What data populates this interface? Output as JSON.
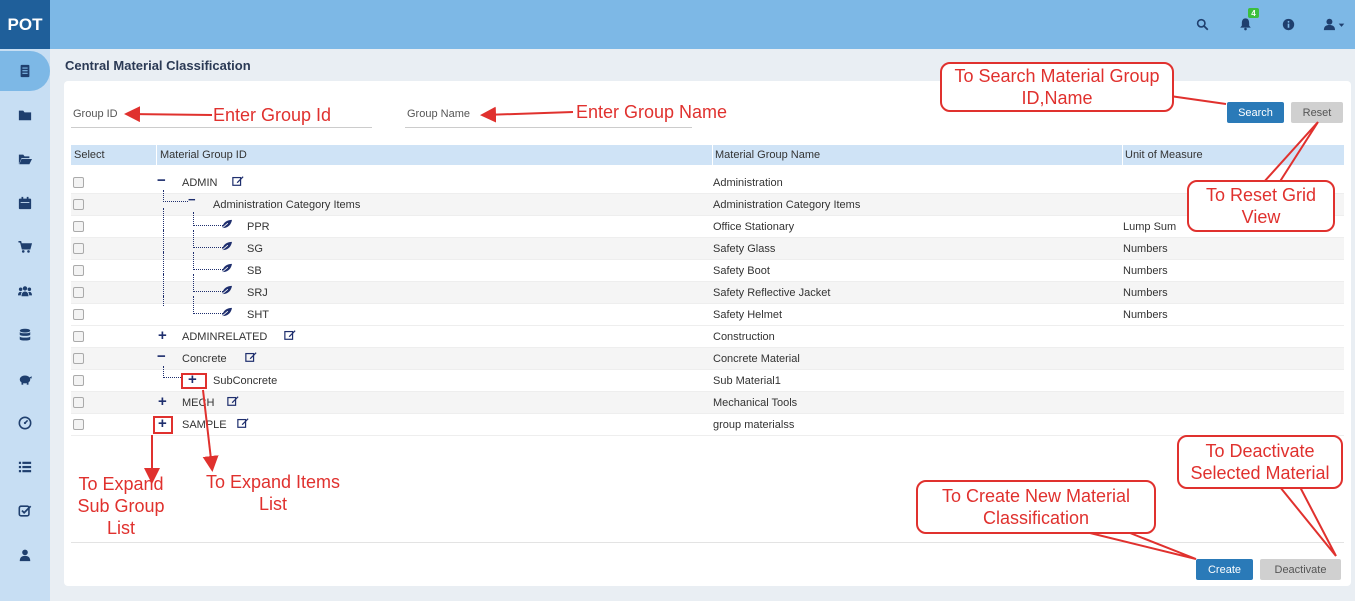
{
  "app": {
    "logo": "POT"
  },
  "topbar": {
    "icons": [
      "search-icon",
      "bell-icon",
      "info-icon",
      "user-icon"
    ],
    "notification_count": "4"
  },
  "sidebar": {
    "items": [
      "document-icon",
      "folder-icon",
      "folder-open-icon",
      "calendar-icon",
      "cart-icon",
      "users-icon",
      "database-icon",
      "piggy-bank-icon",
      "dashboard-icon",
      "list-icon",
      "checklist-icon",
      "user-icon"
    ],
    "active_index": 0
  },
  "page": {
    "title": "Central Material Classification"
  },
  "filters": {
    "group_id_label": "Group ID",
    "group_name_label": "Group Name",
    "search_label": "Search",
    "reset_label": "Reset"
  },
  "grid": {
    "headers": {
      "select": "Select",
      "id": "Material Group ID",
      "name": "Material Group Name",
      "uom": "Unit of Measure"
    },
    "rows": [
      {
        "id": "ADMIN",
        "name": "Administration",
        "uom": ""
      },
      {
        "id": "Administration Category Items",
        "name": "Administration Category Items",
        "uom": ""
      },
      {
        "id": "PPR",
        "name": "Office Stationary",
        "uom": "Lump Sum"
      },
      {
        "id": "SG",
        "name": "Safety Glass",
        "uom": "Numbers"
      },
      {
        "id": "SB",
        "name": "Safety Boot",
        "uom": "Numbers"
      },
      {
        "id": "SRJ",
        "name": "Safety Reflective Jacket",
        "uom": "Numbers"
      },
      {
        "id": "SHT",
        "name": "Safety Helmet",
        "uom": "Numbers"
      },
      {
        "id": "ADMINRELATED",
        "name": "Construction",
        "uom": ""
      },
      {
        "id": "Concrete",
        "name": "Concrete Material",
        "uom": ""
      },
      {
        "id": "SubConcrete",
        "name": "Sub Material1",
        "uom": ""
      },
      {
        "id": "MECH",
        "name": "Mechanical Tools",
        "uom": ""
      },
      {
        "id": "SAMPLE",
        "name": "group materialss",
        "uom": ""
      }
    ],
    "expand_symbol": "+",
    "collapse_symbol": "−"
  },
  "actions": {
    "create_label": "Create",
    "deactivate_label": "Deactivate"
  },
  "annotations": {
    "enter_group_id": "Enter Group Id",
    "enter_group_name": "Enter Group Name",
    "search_hint": "To Search Material Group ID,Name",
    "reset_hint": "To Reset Grid View",
    "expand_sub_group": "To Expand Sub Group List",
    "expand_items": "To Expand Items List",
    "create_hint": "To Create New Material Classification",
    "deactivate_hint": "To Deactivate Selected Material"
  },
  "colors": {
    "topbar": "#7db8e6",
    "sidebar": "#c7def3",
    "primary": "#2a7ab8",
    "annotation": "#e0312e"
  }
}
